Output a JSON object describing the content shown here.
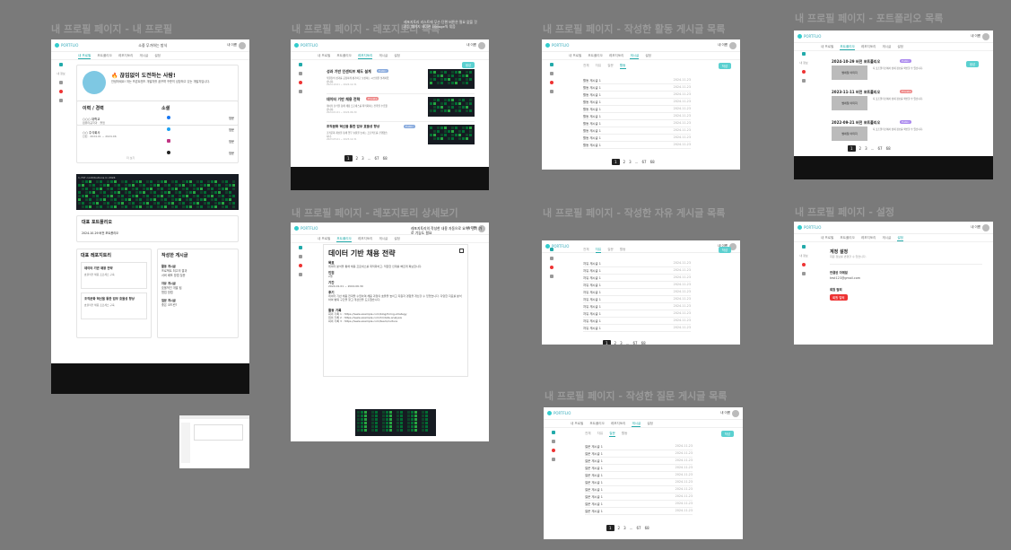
{
  "frames": {
    "profile": {
      "title": "내 프로필 페이지 - 내 프로필"
    },
    "repos": {
      "title": "내 프로필 페이지 - 레포지토리 목록"
    },
    "activity": {
      "title": "내 프로필 페이지 - 작성한 활동 게시글 목록"
    },
    "portfolio": {
      "title": "내 프로필 페이지 - 포트폴리오 목록"
    },
    "repo_detail": {
      "title": "내 프로필 페이지 - 레포지토리 상세보기"
    },
    "free": {
      "title": "내 프로필 페이지 - 작성한 자유 게시글 목록"
    },
    "settings": {
      "title": "내 프로필 페이지 - 설정"
    },
    "question": {
      "title": "내 프로필 페이지 - 작성한 질문 게시글 목록"
    }
  },
  "repos_overlay_note": "레포지토리 리스트에 무슨 단편 버튼은 필요 없을 것 같음 페이지 네이션 10page씩 묶음",
  "repo_detail_note": "레포지토리의 작성한 내용 자동으로 요약? 단기 가로 기능도 필요",
  "header": {
    "logo": "PORTFLIO",
    "user": "내 이름",
    "search": "소중 무가하는 방식"
  },
  "tabs": {
    "t1": "내 프로필",
    "t2": "포트폴리오",
    "t3": "레포지토리",
    "t4": "게시글",
    "t5": "설정"
  },
  "side": {
    "s1": "내 정보",
    "s2": "받은 알림함",
    "s3": "알림",
    "s4": "설정"
  },
  "profile": {
    "headline": "🔥 끊임없이 도전하는 사람!",
    "bio": "안녕하세요! 저는 프론트엔드 개발자를 꿈꾸며 꾸준히 성장하고 있는 개발자입니다.",
    "edu_title": "이력 / 경력",
    "edu1": "○○○ 대학교",
    "edu1_sub": "컴퓨터공학과 · 졸업",
    "edu2": "○○ 주식회사",
    "edu2_sub": "인턴 · 2024.01 ~ 2024.06",
    "social_title": "소셜",
    "social": [
      {
        "icon": "facebook-icon",
        "label": "방문"
      },
      {
        "icon": "twitter-icon",
        "label": "방문"
      },
      {
        "icon": "instagram-icon",
        "label": "방문"
      },
      {
        "icon": "github-icon",
        "label": "방문"
      }
    ],
    "more": "더 보기",
    "contrib_title": "1,747 contributions in 2024",
    "portfolio_title": "대표 포트폴리오",
    "portfolio_item": "2024-10-29 버전 포트폴리오",
    "rep_repo_title": "대표 레포지토리",
    "rep_repo1": "데이터 기반 채용 전략",
    "rep_repo1_sub": "효율적인 채용 프로세스 구축",
    "rep_repo2": "조직문화 혁신을 통한 업무 효율성 향상",
    "rep_repo2_sub": "효율적인 채용 프로세스 구축",
    "posts_title": "작성한 게시글",
    "posts_a": "활동 게시글",
    "posts_b": "자유 게시글",
    "posts_c": "질문 게시글",
    "posts_items": [
      "프로젝트 최고의 결과",
      "서버 배포 방법 질문",
      "효율적인 개발 팁",
      "협업 방법",
      "좋은 코드란?"
    ]
  },
  "repos": {
    "btn": "생성",
    "items": [
      {
        "title": "성과 기반 인센티브 제도 설계",
        "badge": "Public",
        "desc": "직원들의 성과를 공정하게 평가하고 보상하는 시스템을 설계하였습니다.",
        "date": "2024.10.01 ~ 2024.12.31"
      },
      {
        "title": "데이터 기반 채용 전략",
        "badge": "Private",
        "desc": "데이터 분석을 통해 채용 프로세스를 최적화하는 전략을 수립했습니다.",
        "date": "2024.01.01 ~ 2024.06.30"
      },
      {
        "title": "조직문화 혁신을 통한 업무 효율성 향상",
        "badge": "Public",
        "desc": "조직문화 개선을 통해 업무 효율을 높이는 프로젝트를 진행했습니다.",
        "date": "2023.05.01 ~ 2023.12.31"
      }
    ],
    "pages": [
      "1",
      "2",
      "3",
      "...",
      "67",
      "68"
    ]
  },
  "activity": {
    "cats": [
      "전체",
      "자유",
      "질문",
      "활동"
    ],
    "btn": "작성",
    "items": [
      "활동 게시글 1",
      "활동 게시글 1",
      "활동 게시글 1",
      "활동 게시글 1",
      "활동 게시글 1",
      "활동 게시글 1",
      "활동 게시글 1",
      "활동 게시글 1",
      "활동 게시글 1",
      "활동 게시글 1"
    ],
    "date": "2024.11.23",
    "pages": [
      "1",
      "2",
      "3",
      "...",
      "67",
      "68"
    ]
  },
  "portfolio": {
    "btn": "생성",
    "items": [
      {
        "title": "2024-10-29 버전 포트폴리오",
        "badge": "Public",
        "thumb": "썸네일 이미지",
        "desc": "지 포트폴리오에서 상세 정보를 확인할 수 있습니다."
      },
      {
        "title": "2023-11-11 버전 포트폴리오",
        "badge": "Private",
        "thumb": "썸네일 이미지",
        "desc": "지 포트폴리오에서 상세 정보를 확인할 수 있습니다."
      },
      {
        "title": "2022-09-21 버전 포트폴리오",
        "badge": "Public",
        "thumb": "썸네일 이미지",
        "desc": "지 포트폴리오에서 상세 정보를 확인할 수 있습니다."
      }
    ],
    "pages": [
      "1",
      "2",
      "3",
      "...",
      "67",
      "68"
    ]
  },
  "repo_detail": {
    "title": "데이터 기반 채용 전략",
    "s1": "목표",
    "s1_body": "데이터 분석을 통해 채용 프로세스를 최적화하고, 적합한 인재를 빠르게 확보합니다.",
    "s2": "인원",
    "s2_body": "2명",
    "s3": "기간",
    "s3_body": "2024.01.01 ~ 2024.06.30",
    "s4": "후기",
    "s4_body": "데이터 기반 채용 전략을 수립하며 채용 과정의 효율을 높이고 지원자 경험을 개선할 수 있었습니다. 다양한 지표를 분석하여 병목 구간을 찾고 개선안을 도출했습니다.",
    "s5": "활동 기록",
    "links": [
      "회의 기록 1 : https://www.example.com/blog/hiring-strategy",
      "회의 기록 2 : https://www.example.com/hr/data-analysis",
      "회의 기록 3 : https://www.example.com/team/culture"
    ]
  },
  "free": {
    "cats": [
      "전체",
      "자유",
      "질문",
      "활동"
    ],
    "btn": "작성",
    "items": [
      "자유 게시글 1",
      "자유 게시글 1",
      "자유 게시글 1",
      "자유 게시글 1",
      "자유 게시글 1",
      "자유 게시글 1",
      "자유 게시글 1",
      "자유 게시글 1",
      "자유 게시글 1",
      "자유 게시글 1"
    ],
    "date": "2024.11.23",
    "pages": [
      "1",
      "2",
      "3",
      "...",
      "67",
      "68"
    ]
  },
  "settings": {
    "title": "계정 설정",
    "sub": "회원 정보를 변경할 수 있습니다.",
    "email_label": "연결된 이메일",
    "email": "test123@gmail.com",
    "del_label": "회원 탈퇴",
    "del_btn": "회원 탈퇴"
  },
  "question": {
    "cats": [
      "전체",
      "자유",
      "질문",
      "활동"
    ],
    "btn": "작성",
    "items": [
      "질문 게시글 1",
      "질문 게시글 1",
      "질문 게시글 1",
      "질문 게시글 1",
      "질문 게시글 1",
      "질문 게시글 1",
      "질문 게시글 1",
      "질문 게시글 1",
      "질문 게시글 1",
      "질문 게시글 1"
    ],
    "date": "2024.11.23",
    "pages": [
      "1",
      "2",
      "3",
      "...",
      "67",
      "68"
    ]
  }
}
